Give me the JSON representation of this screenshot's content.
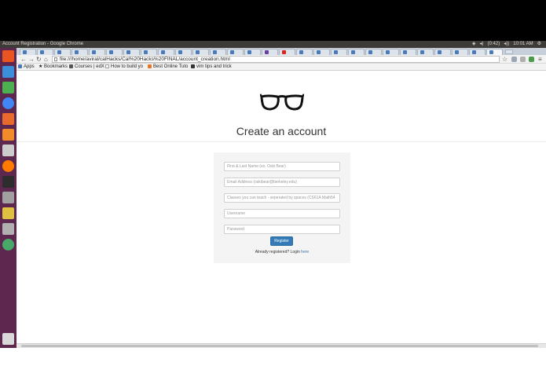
{
  "panel": {
    "window_title": "Account Registration - Google Chrome",
    "battery": "(0:42)",
    "clock": "10:01 AM"
  },
  "address_bar": {
    "url": "file:///home/aviral/calHacks/Cal%20Hacks%20FINAL/account_creation.html"
  },
  "bookmarks": [
    {
      "label": "Apps",
      "icon": "apps-grid-icon"
    },
    {
      "label": "Bookmarks",
      "icon": "star-icon"
    },
    {
      "label": "Courses | edX",
      "icon": "edx-icon"
    },
    {
      "label": "How to build yo",
      "icon": "page-icon"
    },
    {
      "label": "Best Online Tuto",
      "icon": "tutorial-icon"
    },
    {
      "label": "vim tips and trick",
      "icon": "vim-icon"
    }
  ],
  "page": {
    "logo": "glasses-icon",
    "heading": "Create an account",
    "fields": [
      {
        "placeholder": "First & Last Name (ex. Oski Bear)"
      },
      {
        "placeholder": "Email Address (oskibear@berkeley.edu)"
      },
      {
        "placeholder": "Classes you can teach - seperated by spaces (CS61A Math54"
      },
      {
        "placeholder": "Username"
      },
      {
        "placeholder": "Password"
      }
    ],
    "register_label": "Register",
    "login_prompt": "Already registered? Login",
    "login_link": "here"
  },
  "colors": {
    "launcher": "#5e2750",
    "primary_button": "#337ab7",
    "panel": "#3c3b37"
  }
}
